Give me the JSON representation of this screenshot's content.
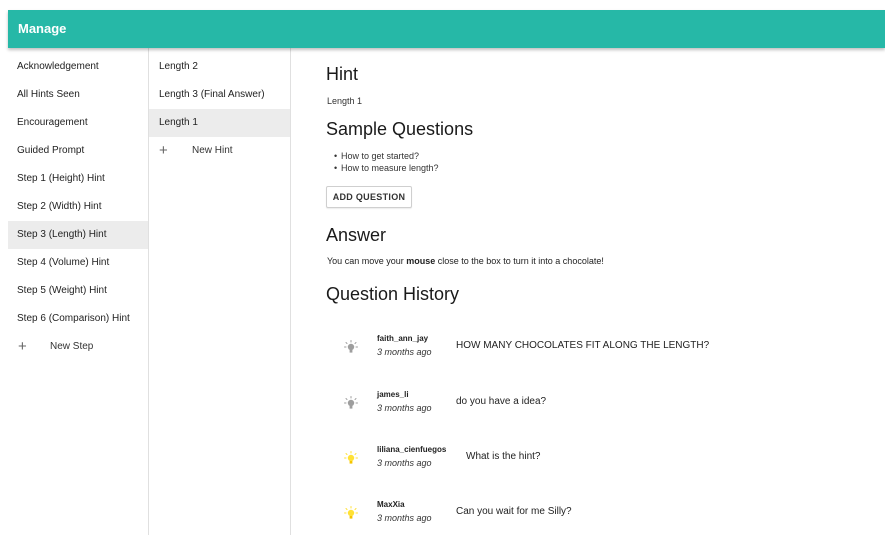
{
  "app": {
    "title": "Manage"
  },
  "steps": {
    "items": [
      {
        "label": "Acknowledgement"
      },
      {
        "label": "All Hints Seen"
      },
      {
        "label": "Encouragement"
      },
      {
        "label": "Guided Prompt"
      },
      {
        "label": "Step 1 (Height) Hint"
      },
      {
        "label": "Step 2 (Width) Hint"
      },
      {
        "label": "Step 3 (Length) Hint"
      },
      {
        "label": "Step 4 (Volume) Hint"
      },
      {
        "label": "Step 5 (Weight) Hint"
      },
      {
        "label": "Step 6 (Comparison) Hint"
      }
    ],
    "selected": "Step 3 (Length) Hint",
    "new_label": "New Step"
  },
  "hints": {
    "items": [
      {
        "label": "Length 2"
      },
      {
        "label": "Length 3 (Final Answer)"
      },
      {
        "label": "Length 1"
      }
    ],
    "selected": "Length 1",
    "new_label": "New Hint"
  },
  "detail": {
    "hint_heading": "Hint",
    "hint_name": "Length 1",
    "sample_heading": "Sample Questions",
    "sample_questions": [
      "How to get started?",
      "How to measure length?"
    ],
    "add_question_label": "ADD QUESTION",
    "answer_heading": "Answer",
    "answer_before": "You can move your ",
    "answer_bold": "mouse",
    "answer_after": " close to the box to turn it into a chocolate!",
    "history_heading": "Question History"
  },
  "history": [
    {
      "user": "faith_ann_jay",
      "time": "3 months ago",
      "message": "HOW MANY CHOCOLATES FIT ALONG THE LENGTH?",
      "icon": "lightbulb-icon",
      "bulb_color": "#9e9e9e"
    },
    {
      "user": "james_li",
      "time": "3 months ago",
      "message": "do you have a idea?",
      "icon": "lightbulb-icon",
      "bulb_color": "#9e9e9e"
    },
    {
      "user": "liliana_cienfuegos",
      "time": "3 months ago",
      "message": "What is the hint?",
      "icon": "lightbulb-icon",
      "bulb_color": "#ffe135"
    },
    {
      "user": "MaxXia",
      "time": "3 months ago",
      "message": "Can you wait for me Silly?",
      "icon": "lightbulb-icon",
      "bulb_color": "#ffe135"
    }
  ],
  "colors": {
    "accent": "#26b8a7",
    "selected_bg": "#ececec"
  }
}
